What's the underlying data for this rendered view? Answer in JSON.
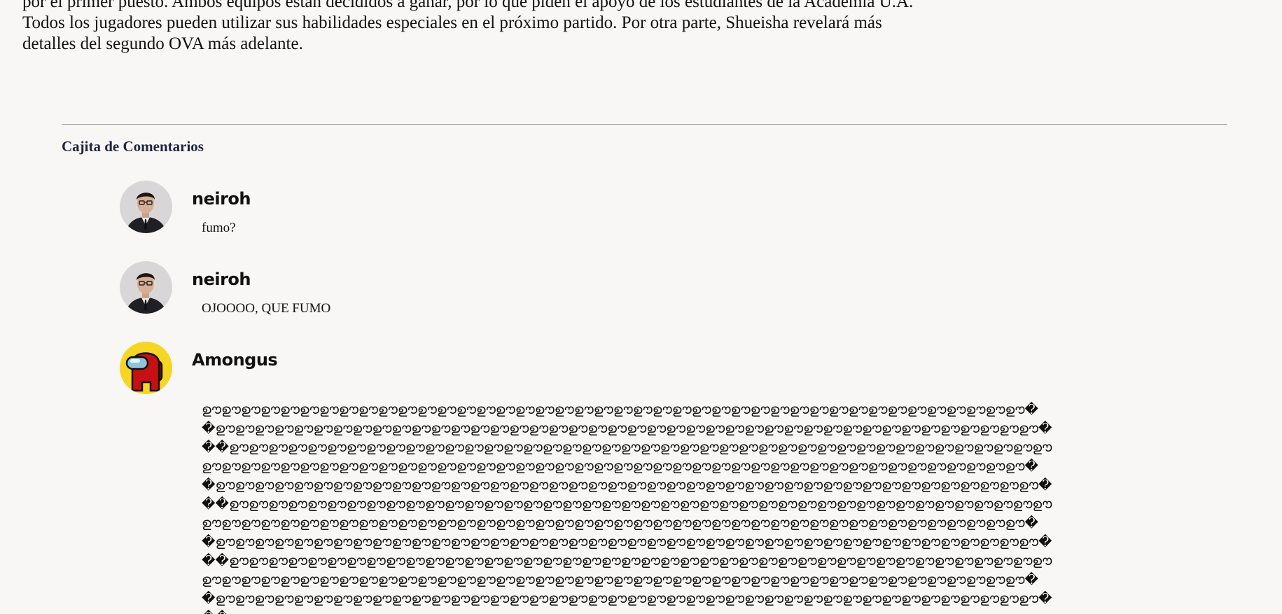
{
  "article": {
    "lines": [
      "por el primer puesto. Ambos equipos están decididos a ganar, por lo que piden el apoyo de los estudiantes de la Academia U.A.",
      "Todos los jugadores pueden utilizar sus habilidades especiales en el próximo partido. Por otra parte, Shueisha revelará más",
      "detalles del segundo OVA más adelante."
    ]
  },
  "comments_section": {
    "heading": "Cajita de Comentarios",
    "comments": [
      {
        "author": "neiroh",
        "text": "fumo?",
        "avatar_icon": "user-photo-avatar"
      },
      {
        "author": "neiroh",
        "text": "OJOOOO, QUE FUMO",
        "avatar_icon": "user-photo-avatar"
      },
      {
        "author": "Amongus",
        "avatar_icon": "among-us-crewmate-avatar",
        "text_lines": [
          "ഊഊഊഊഊഊഊഊഊഊഊഊഊഊഊഊഊഊഊഊഊഊഊഊഊഊഊഊഊഊഊഊഊഊഊഊഊഊഊഊഊഊ�",
          "�ഊഊഊഊഊഊഊഊഊഊഊഊഊഊഊഊഊഊഊഊഊഊഊഊഊഊഊഊഊഊഊഊഊഊഊഊഊഊഊഊഊഊ�",
          "��ഊഊഊഊഊഊഊഊഊഊഊഊഊഊഊഊഊഊഊഊഊഊഊഊഊഊഊഊഊഊഊഊഊഊഊഊഊഊഊഊഊഊ",
          "ഊഊഊഊഊഊഊഊഊഊഊഊഊഊഊഊഊഊഊഊഊഊഊഊഊഊഊഊഊഊഊഊഊഊഊഊഊഊഊഊഊഊ�",
          "�ഊഊഊഊഊഊഊഊഊഊഊഊഊഊഊഊഊഊഊഊഊഊഊഊഊഊഊഊഊഊഊഊഊഊഊഊഊഊഊഊഊഊ�",
          "��ഊഊഊഊഊഊഊഊഊഊഊഊഊഊഊഊഊഊഊഊഊഊഊഊഊഊഊഊഊഊഊഊഊഊഊഊഊഊഊഊഊഊ",
          "ഊഊഊഊഊഊഊഊഊഊഊഊഊഊഊഊഊഊഊഊഊഊഊഊഊഊഊഊഊഊഊഊഊഊഊഊഊഊഊഊഊഊ�",
          "�ഊഊഊഊഊഊഊഊഊഊഊഊഊഊഊഊഊഊഊഊഊഊഊഊഊഊഊഊഊഊഊഊഊഊഊഊഊഊഊഊഊഊ�",
          "��ഊഊഊഊഊഊഊഊഊഊഊഊഊഊഊഊഊഊഊഊഊഊഊഊഊഊഊഊഊഊഊഊഊഊഊഊഊഊഊഊഊഊ",
          "ഊഊഊഊഊഊഊഊഊഊഊഊഊഊഊഊഊഊഊഊഊഊഊഊഊഊഊഊഊഊഊഊഊഊഊഊഊഊഊഊഊഊ�",
          "�ഊഊഊഊഊഊഊഊഊഊഊഊഊഊഊഊഊഊഊഊഊഊഊഊഊഊഊഊഊഊഊഊഊഊഊഊഊഊഊഊഊഊ�",
          "��ഊഊഊഊഊഊഊഊഊഊഊഊഊഊഊഊഊഊഊഊഊഊഊഊഊഊഊഊഊഊ"
        ]
      }
    ]
  },
  "colors": {
    "background": "#f8f7f6",
    "heading": "#1f2440",
    "divider": "#9a9a9a",
    "crewmate_red": "#c51111",
    "crewmate_bg": "#f5d623"
  }
}
